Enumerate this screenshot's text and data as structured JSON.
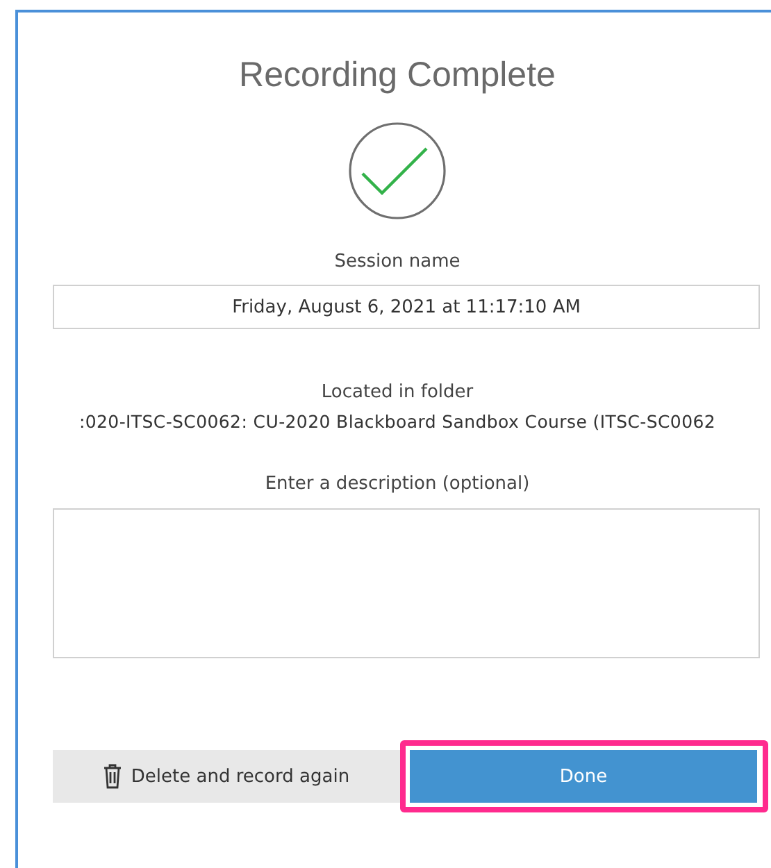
{
  "dialog": {
    "title": "Recording Complete",
    "completed": true
  },
  "session": {
    "label": "Session name",
    "value": "Friday, August 6, 2021 at 11:17:10 AM"
  },
  "folder": {
    "label": "Located in folder",
    "path": ":020-ITSC-SC0062: CU-2020 Blackboard Sandbox Course (ITSC-SC0062"
  },
  "description": {
    "label": "Enter a description (optional)"
  },
  "buttons": [
    {
      "kind": "secondary",
      "label": "Delete and record again",
      "highlighted": false
    },
    {
      "kind": "primary",
      "label": "Done",
      "highlighted": true
    }
  ]
}
